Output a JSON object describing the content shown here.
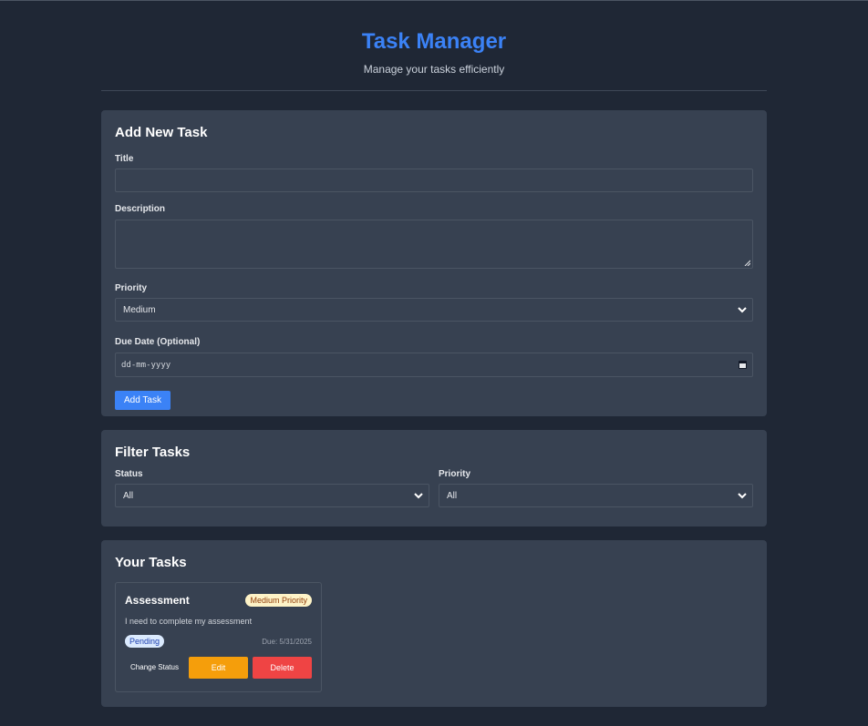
{
  "header": {
    "title": "Task Manager",
    "subtitle": "Manage your tasks efficiently"
  },
  "add_task": {
    "heading": "Add New Task",
    "title_label": "Title",
    "title_value": "",
    "description_label": "Description",
    "description_value": "",
    "priority_label": "Priority",
    "priority_value": "Medium",
    "due_label": "Due Date (Optional)",
    "due_placeholder": "dd-mm-yyyy",
    "submit_label": "Add Task"
  },
  "filter": {
    "heading": "Filter Tasks",
    "status_label": "Status",
    "status_value": "All",
    "priority_label": "Priority",
    "priority_value": "All"
  },
  "tasks": {
    "heading": "Your Tasks",
    "items": [
      {
        "title": "Assessment",
        "priority_badge": "Medium Priority",
        "description": "I need to complete my assessment",
        "status": "Pending",
        "due": "Due: 5/31/2025",
        "change_status_label": "Change Status",
        "edit_label": "Edit",
        "delete_label": "Delete"
      }
    ]
  },
  "icons": {
    "select_arrow": "chevron-down-icon",
    "date_picker": "calendar-icon",
    "textarea_resize": "resize-grip-icon"
  },
  "colors": {
    "accent": "#3b82f6",
    "background": "#1f2735",
    "card": "#374151",
    "edit": "#f59e0b",
    "delete": "#ef4444",
    "priority_badge_bg": "#fef3c7",
    "status_badge_bg": "#dbeafe"
  }
}
